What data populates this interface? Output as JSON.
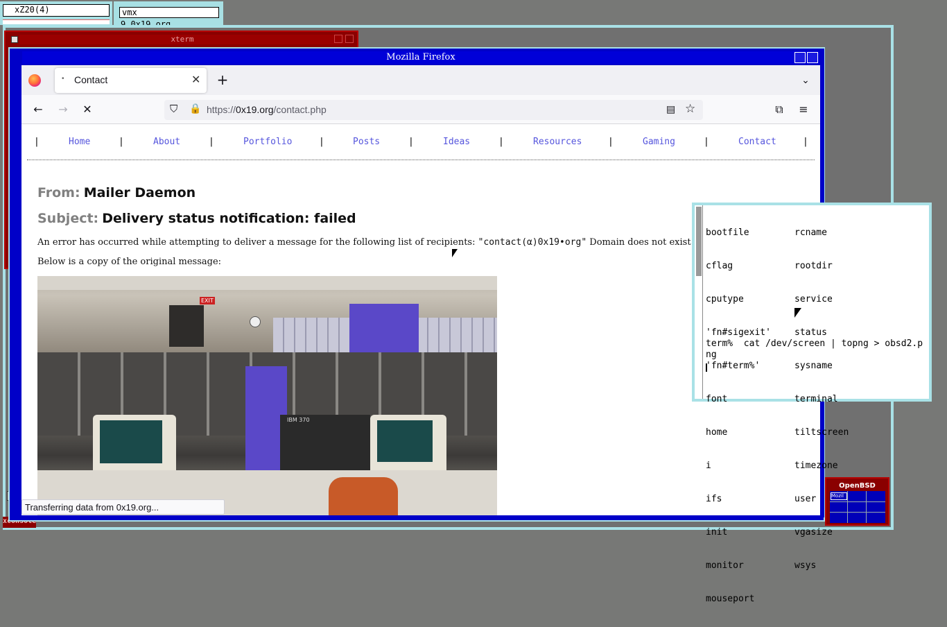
{
  "mini_windows": {
    "left_title": "xZ20(4)",
    "right_title": "vmx",
    "right_line": "9 0x19.org"
  },
  "xterm": {
    "title": "xterm"
  },
  "firefox": {
    "window_title": "Mozilla Firefox",
    "tab_label": "Contact",
    "new_tab": "+",
    "url_prefix": "https://",
    "url_host": "0x19.org",
    "url_path": "/contact.php",
    "status": "Transferring data from 0x19.org..."
  },
  "site_nav": {
    "items": [
      {
        "label": "Home"
      },
      {
        "label": "About"
      },
      {
        "label": "Portfolio"
      },
      {
        "label": "Posts"
      },
      {
        "label": "Ideas"
      },
      {
        "label": "Resources"
      },
      {
        "label": "Gaming"
      },
      {
        "label": "Contact"
      }
    ],
    "separator": "|"
  },
  "message": {
    "from_label": "From:",
    "from_value": "Mailer Daemon",
    "subject_label": "Subject:",
    "subject_value": "Delivery status notification: failed",
    "error_pre": "An error has occurred while attempting to deliver a message for the following list of recipients: ",
    "error_address": "\"contact(α)0x19•org\"",
    "error_post": " Domain does not exist",
    "copy_line": "Below is a copy of the original message:"
  },
  "photo_sign_exit": "EXIT",
  "photo_ibm_label": "IBM  370",
  "terminal": {
    "col1": [
      "bootfile",
      "cflag",
      "cputype",
      "'fn#sigexit'",
      "'fn#term%'",
      "font",
      "home",
      "i",
      "ifs",
      "init",
      "monitor",
      "mouseport"
    ],
    "col2": [
      "rcname",
      "rootdir",
      "service",
      "status",
      "sysname",
      "terminal",
      "tiltscreen",
      "timezone",
      "user",
      "vgasize",
      "wsys"
    ],
    "command_line1": "term%  cat /dev/screen | topng > obsd2.p",
    "command_line2": "ng"
  },
  "pager": {
    "title": "OpenBSD",
    "thumb": "Mozil"
  },
  "xconsole": "xconsole"
}
